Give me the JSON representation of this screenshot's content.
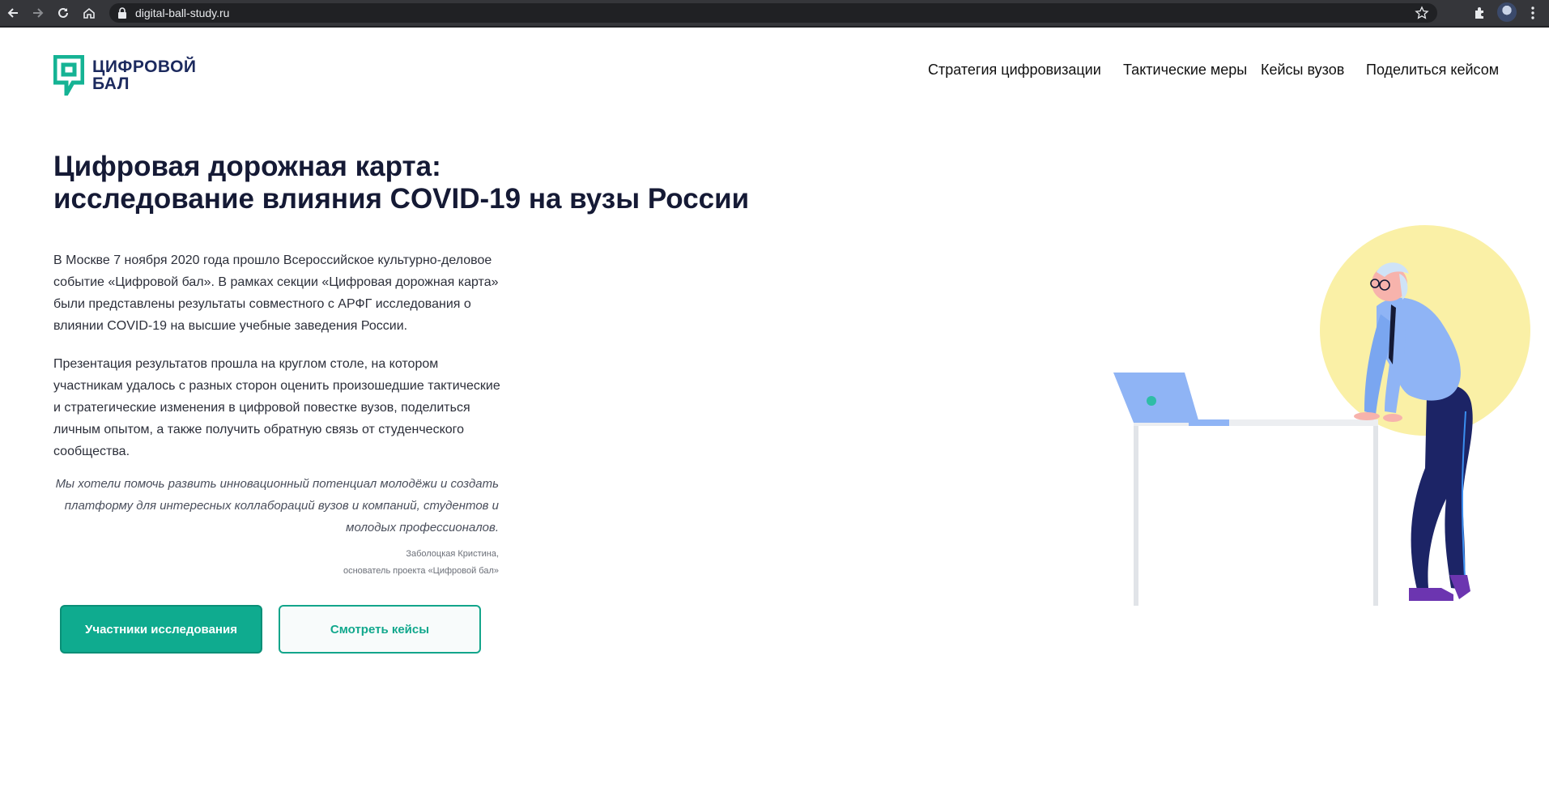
{
  "browser": {
    "url": "digital-ball-study.ru"
  },
  "logo": {
    "line1": "ЦИФРОВОЙ",
    "line2": "БАЛ"
  },
  "nav": [
    {
      "label": "Стратегия цифровизации"
    },
    {
      "label": "Тактические меры"
    },
    {
      "label": "Кейсы вузов"
    },
    {
      "label": "Поделиться кейсом"
    }
  ],
  "hero": {
    "title_line1": "Цифровая дорожная карта:",
    "title_line2": "исследование влияния COVID-19 на вузы России",
    "paragraph1": "В Москве 7 ноября 2020 года прошло Всероссийское культурно-деловое событие «Цифровой бал». В рамках секции «Цифровая дорожная карта» были представлены результаты совместного с АРФГ исследования о влиянии COVID-19 на высшие учебные заведения России.",
    "paragraph2": "Презентация результатов прошла на круглом столе, на котором участникам удалось с разных сторон оценить произошедшие тактические и стратегические изменения в цифровой повестке вузов, поделиться личным опытом, а также получить обратную связь от студенческого сообщества.",
    "quote": "Мы хотели помочь развить инновационный потенциал молодёжи и создать платформу для интересных коллабораций вузов и компаний, студентов и молодых профессионалов.",
    "author_name": "Заболоцкая Кристина,",
    "author_role": "основатель проекта «Цифровой бал»"
  },
  "buttons": {
    "primary": "Участники исследования",
    "secondary": "Смотреть кейсы"
  },
  "colors": {
    "accent": "#0fab8f",
    "navy": "#1c2a5e",
    "circle": "#faf0a6"
  }
}
